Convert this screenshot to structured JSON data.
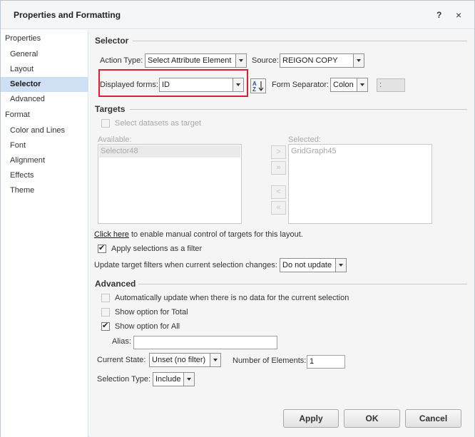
{
  "dialog": {
    "title": "Properties and Formatting",
    "help_label": "?",
    "close_label": "×"
  },
  "sidebar": {
    "group_properties": "Properties",
    "group_format": "Format",
    "properties_items": [
      "General",
      "Layout",
      "Selector",
      "Advanced"
    ],
    "format_items": [
      "Color and Lines",
      "Font",
      "Alignment",
      "Effects",
      "Theme"
    ],
    "active_item": "Selector"
  },
  "selector": {
    "section_title": "Selector",
    "action_type_label": "Action Type:",
    "action_type_value": "Select Attribute Element",
    "source_label": "Source:",
    "source_value": "REIGON COPY",
    "displayed_forms_label": "Displayed forms:",
    "displayed_forms_value": "ID",
    "form_separator_label": "Form Separator:",
    "form_separator_value": "Colon",
    "separator_char": ":"
  },
  "targets": {
    "section_title": "Targets",
    "select_datasets_label": "Select datasets as target",
    "available_label": "Available:",
    "available_items": [
      "Selector48"
    ],
    "selected_label": "Selected:",
    "selected_items": [
      "GridGraph45"
    ],
    "click_here": "Click here",
    "click_here_rest": " to enable manual control of targets for this layout.",
    "apply_filter_label": "Apply selections as a filter",
    "update_label": "Update target filters when current selection changes:",
    "update_value": "Do not update"
  },
  "advanced": {
    "section_title": "Advanced",
    "auto_update_label": "Automatically update when there is no data for the current selection",
    "show_total_label": "Show option for Total",
    "show_all_label": "Show option for All",
    "alias_label": "Alias:",
    "alias_value": "",
    "current_state_label": "Current State:",
    "current_state_value": "Unset (no filter)",
    "num_elements_label": "Number of Elements:",
    "num_elements_value": "1",
    "selection_type_label": "Selection Type:",
    "selection_type_value": "Include"
  },
  "footer": {
    "apply": "Apply",
    "ok": "OK",
    "cancel": "Cancel"
  },
  "colors": {
    "highlight": "#d4232f",
    "active_item_bg": "#cfe0f4"
  },
  "icons": {
    "sort": "sort-az-icon",
    "help": "help-icon",
    "close": "close-icon"
  }
}
